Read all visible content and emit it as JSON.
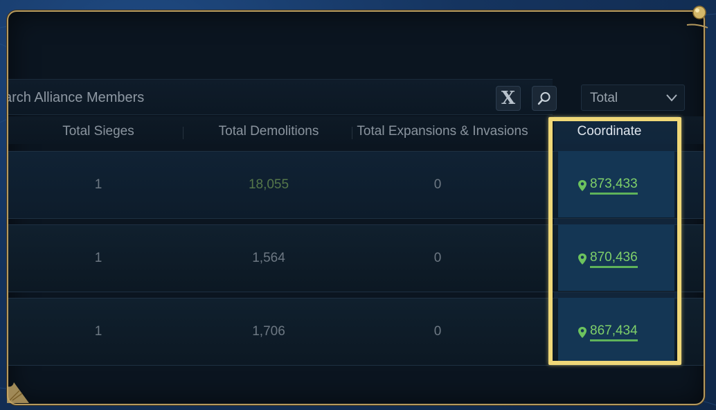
{
  "search": {
    "placeholder": "arch Alliance Members"
  },
  "filter": {
    "selected": "Total"
  },
  "columns": {
    "sieges": "Total Sieges",
    "demolitions": "Total Demolitions",
    "expansions": "Total Expansions & Invasions",
    "coordinate": "Coordinate"
  },
  "rows": [
    {
      "sieges": "1",
      "demolitions": "18,055",
      "expansions": "0",
      "coordinate": "873,433"
    },
    {
      "sieges": "1",
      "demolitions": "1,564",
      "expansions": "0",
      "coordinate": "870,436"
    },
    {
      "sieges": "1",
      "demolitions": "1,706",
      "expansions": "0",
      "coordinate": "867,434"
    }
  ],
  "colors": {
    "frame_gold": "#b69a5e",
    "highlight_yellow": "#f0d878",
    "coordinate_green": "#7fd06a",
    "panel_bg": "#0b1520"
  },
  "icons": [
    "clear-x-icon",
    "search-icon",
    "chevron-down-icon",
    "map-pin-icon",
    "ornament-icon"
  ]
}
